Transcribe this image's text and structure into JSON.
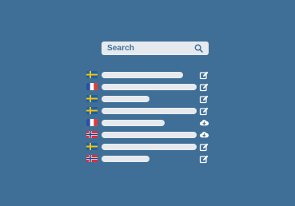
{
  "search": {
    "label": "Search",
    "icon": "search-icon"
  },
  "colors": {
    "background": "#3f6f97",
    "bar": "#e6eaef",
    "accent": "#3f6f97",
    "icon": "#ffffff"
  },
  "rows": [
    {
      "flag": "sweden",
      "action": "edit",
      "bar_fraction": 0.86
    },
    {
      "flag": "france",
      "action": "edit",
      "bar_fraction": 1.0
    },
    {
      "flag": "sweden",
      "action": "edit",
      "bar_fraction": 0.5
    },
    {
      "flag": "sweden",
      "action": "edit",
      "bar_fraction": 1.0
    },
    {
      "flag": "france",
      "action": "download",
      "bar_fraction": 0.66
    },
    {
      "flag": "norway",
      "action": "download",
      "bar_fraction": 1.0
    },
    {
      "flag": "sweden",
      "action": "edit",
      "bar_fraction": 1.0
    },
    {
      "flag": "norway",
      "action": "edit",
      "bar_fraction": 0.5
    }
  ]
}
